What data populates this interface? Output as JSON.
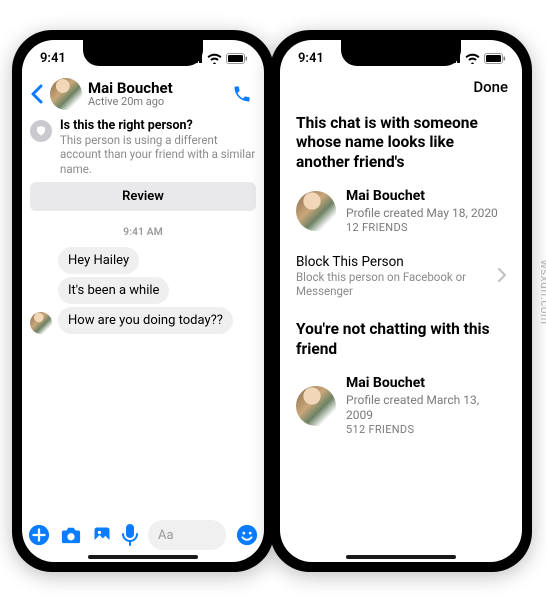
{
  "status": {
    "time": "9:41"
  },
  "accent": "#0a7cff",
  "left": {
    "chat_name": "Mai Bouchet",
    "chat_sub": "Active 20m ago",
    "warn_title": "Is this the right person?",
    "warn_body": "This person is using a different account than your friend with a similar name.",
    "review": "Review",
    "timestamp": "9:41 AM",
    "messages": [
      "Hey Hailey",
      "It's been a while",
      "How are you doing today??"
    ],
    "composer_placeholder": "Aa"
  },
  "right": {
    "done": "Done",
    "section1_title": "This chat is with someone whose name looks like another friend's",
    "profile1": {
      "name": "Mai Bouchet",
      "created": "Profile created May 18, 2020",
      "friends": "12 FRIENDS"
    },
    "block_title": "Block This Person",
    "block_sub": "Block this person on Facebook or Messenger",
    "section2_title": "You're not chatting with this friend",
    "profile2": {
      "name": "Mai Bouchet",
      "created": "Profile created March 13, 2009",
      "friends": "512 FRIENDS"
    }
  },
  "watermark": "wsxdn.com"
}
